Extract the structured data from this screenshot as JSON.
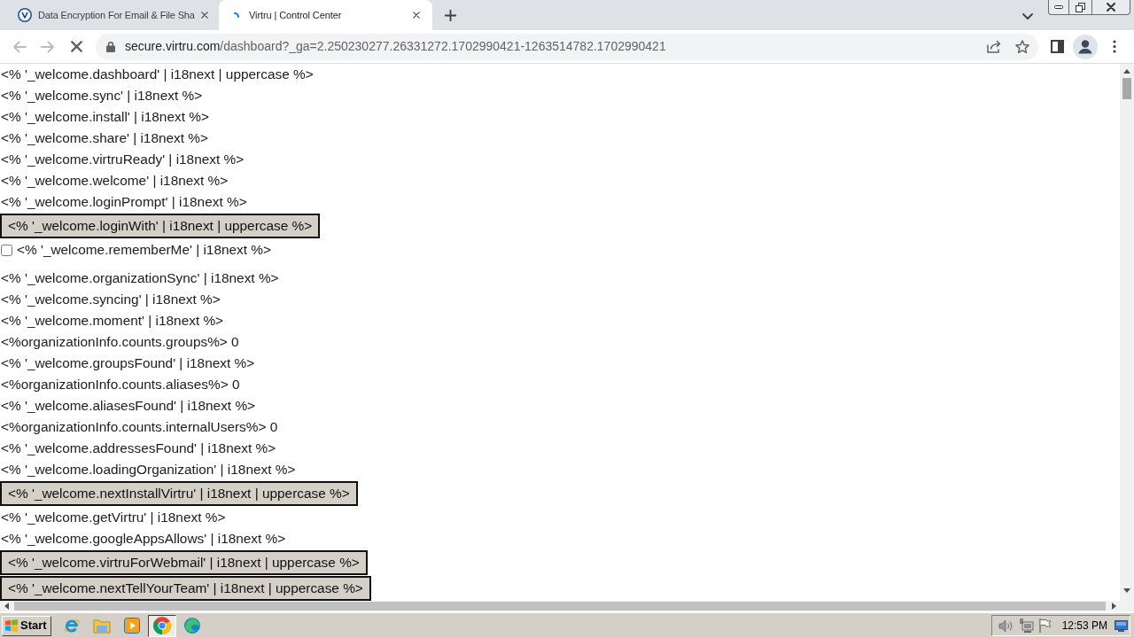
{
  "browser": {
    "tabs": [
      {
        "title": "Data Encryption For Email & File Sha",
        "selected": false,
        "loading": false
      },
      {
        "title": "Virtru | Control Center",
        "selected": true,
        "loading": true
      }
    ],
    "toolbar": {
      "back_disabled": true,
      "forward_disabled": true,
      "loading": true
    },
    "address_bar": {
      "host": "secure.virtru.com",
      "path": "/dashboard?_ga=2.250230277.26331272.1702990421-1263514782.1702990421"
    }
  },
  "page": {
    "items": [
      {
        "kind": "text",
        "text": "<% '_welcome.dashboard' | i18next | uppercase %>"
      },
      {
        "kind": "text",
        "text": "<% '_welcome.sync' | i18next %>"
      },
      {
        "kind": "text",
        "text": "<% '_welcome.install' | i18next %>"
      },
      {
        "kind": "text",
        "text": "<% '_welcome.share' | i18next %>"
      },
      {
        "kind": "text",
        "text": "<% '_welcome.virtruReady' | i18next %>"
      },
      {
        "kind": "text",
        "text": "<% '_welcome.welcome' | i18next %>"
      },
      {
        "kind": "text",
        "text": "<% '_welcome.loginPrompt' | i18next %>"
      },
      {
        "kind": "button",
        "text": "<% '_welcome.loginWith' | i18next | uppercase %>"
      },
      {
        "kind": "checkbox",
        "label": "<% '_welcome.rememberMe' | i18next %>",
        "checked": false
      },
      {
        "kind": "text",
        "text": "<% '_welcome.organizationSync' | i18next %>"
      },
      {
        "kind": "text",
        "text": "<% '_welcome.syncing' | i18next %>"
      },
      {
        "kind": "text",
        "text": "<% '_welcome.moment' | i18next %>"
      },
      {
        "kind": "text",
        "text": "<%organizationInfo.counts.groups%> 0"
      },
      {
        "kind": "text",
        "text": "<% '_welcome.groupsFound' | i18next %>"
      },
      {
        "kind": "text",
        "text": "<%organizationInfo.counts.aliases%> 0"
      },
      {
        "kind": "text",
        "text": "<% '_welcome.aliasesFound' | i18next %>"
      },
      {
        "kind": "text",
        "text": "<%organizationInfo.counts.internalUsers%> 0"
      },
      {
        "kind": "text",
        "text": "<% '_welcome.addressesFound' | i18next %>"
      },
      {
        "kind": "text",
        "text": "<% '_welcome.loadingOrganization' | i18next %>"
      },
      {
        "kind": "button",
        "text": "<% '_welcome.nextInstallVirtru' | i18next | uppercase %>"
      },
      {
        "kind": "text",
        "text": "<% '_welcome.getVirtru' | i18next %>"
      },
      {
        "kind": "text",
        "text": "<% '_welcome.googleAppsAllows' | i18next %>"
      },
      {
        "kind": "button",
        "text": "<% '_welcome.virtruForWebmail' | i18next | uppercase %>"
      },
      {
        "kind": "button",
        "text": "<% '_welcome.nextTellYourTeam' | i18next | uppercase %>"
      }
    ]
  },
  "taskbar": {
    "start_label": "Start",
    "apps": [
      {
        "kind": "ie",
        "selected": false
      },
      {
        "kind": "folder",
        "selected": false
      },
      {
        "kind": "media",
        "selected": false
      },
      {
        "kind": "chrome",
        "selected": true
      },
      {
        "kind": "edge",
        "selected": false
      }
    ],
    "clock": "12:53 PM"
  }
}
